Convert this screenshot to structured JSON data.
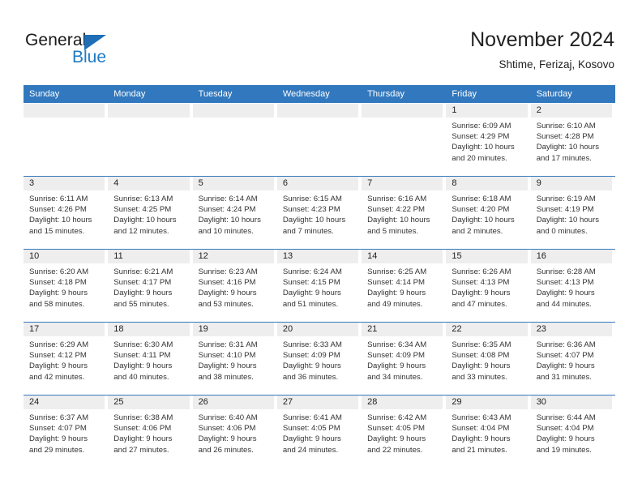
{
  "brand": {
    "name_part1": "General",
    "name_part2": "Blue",
    "triangle_color": "#1f6fb6",
    "blue_text_color": "#1f7bc4"
  },
  "header": {
    "title": "November 2024",
    "location": "Shtime, Ferizaj, Kosovo",
    "accent_color": "#3278be",
    "daynum_band_color": "#eeeeee"
  },
  "weekdays": [
    "Sunday",
    "Monday",
    "Tuesday",
    "Wednesday",
    "Thursday",
    "Friday",
    "Saturday"
  ],
  "weeks": [
    [
      {
        "day": "",
        "sunrise": "",
        "sunset": "",
        "daylight1": "",
        "daylight2": ""
      },
      {
        "day": "",
        "sunrise": "",
        "sunset": "",
        "daylight1": "",
        "daylight2": ""
      },
      {
        "day": "",
        "sunrise": "",
        "sunset": "",
        "daylight1": "",
        "daylight2": ""
      },
      {
        "day": "",
        "sunrise": "",
        "sunset": "",
        "daylight1": "",
        "daylight2": ""
      },
      {
        "day": "",
        "sunrise": "",
        "sunset": "",
        "daylight1": "",
        "daylight2": ""
      },
      {
        "day": "1",
        "sunrise": "Sunrise: 6:09 AM",
        "sunset": "Sunset: 4:29 PM",
        "daylight1": "Daylight: 10 hours",
        "daylight2": "and 20 minutes."
      },
      {
        "day": "2",
        "sunrise": "Sunrise: 6:10 AM",
        "sunset": "Sunset: 4:28 PM",
        "daylight1": "Daylight: 10 hours",
        "daylight2": "and 17 minutes."
      }
    ],
    [
      {
        "day": "3",
        "sunrise": "Sunrise: 6:11 AM",
        "sunset": "Sunset: 4:26 PM",
        "daylight1": "Daylight: 10 hours",
        "daylight2": "and 15 minutes."
      },
      {
        "day": "4",
        "sunrise": "Sunrise: 6:13 AM",
        "sunset": "Sunset: 4:25 PM",
        "daylight1": "Daylight: 10 hours",
        "daylight2": "and 12 minutes."
      },
      {
        "day": "5",
        "sunrise": "Sunrise: 6:14 AM",
        "sunset": "Sunset: 4:24 PM",
        "daylight1": "Daylight: 10 hours",
        "daylight2": "and 10 minutes."
      },
      {
        "day": "6",
        "sunrise": "Sunrise: 6:15 AM",
        "sunset": "Sunset: 4:23 PM",
        "daylight1": "Daylight: 10 hours",
        "daylight2": "and 7 minutes."
      },
      {
        "day": "7",
        "sunrise": "Sunrise: 6:16 AM",
        "sunset": "Sunset: 4:22 PM",
        "daylight1": "Daylight: 10 hours",
        "daylight2": "and 5 minutes."
      },
      {
        "day": "8",
        "sunrise": "Sunrise: 6:18 AM",
        "sunset": "Sunset: 4:20 PM",
        "daylight1": "Daylight: 10 hours",
        "daylight2": "and 2 minutes."
      },
      {
        "day": "9",
        "sunrise": "Sunrise: 6:19 AM",
        "sunset": "Sunset: 4:19 PM",
        "daylight1": "Daylight: 10 hours",
        "daylight2": "and 0 minutes."
      }
    ],
    [
      {
        "day": "10",
        "sunrise": "Sunrise: 6:20 AM",
        "sunset": "Sunset: 4:18 PM",
        "daylight1": "Daylight: 9 hours",
        "daylight2": "and 58 minutes."
      },
      {
        "day": "11",
        "sunrise": "Sunrise: 6:21 AM",
        "sunset": "Sunset: 4:17 PM",
        "daylight1": "Daylight: 9 hours",
        "daylight2": "and 55 minutes."
      },
      {
        "day": "12",
        "sunrise": "Sunrise: 6:23 AM",
        "sunset": "Sunset: 4:16 PM",
        "daylight1": "Daylight: 9 hours",
        "daylight2": "and 53 minutes."
      },
      {
        "day": "13",
        "sunrise": "Sunrise: 6:24 AM",
        "sunset": "Sunset: 4:15 PM",
        "daylight1": "Daylight: 9 hours",
        "daylight2": "and 51 minutes."
      },
      {
        "day": "14",
        "sunrise": "Sunrise: 6:25 AM",
        "sunset": "Sunset: 4:14 PM",
        "daylight1": "Daylight: 9 hours",
        "daylight2": "and 49 minutes."
      },
      {
        "day": "15",
        "sunrise": "Sunrise: 6:26 AM",
        "sunset": "Sunset: 4:13 PM",
        "daylight1": "Daylight: 9 hours",
        "daylight2": "and 47 minutes."
      },
      {
        "day": "16",
        "sunrise": "Sunrise: 6:28 AM",
        "sunset": "Sunset: 4:13 PM",
        "daylight1": "Daylight: 9 hours",
        "daylight2": "and 44 minutes."
      }
    ],
    [
      {
        "day": "17",
        "sunrise": "Sunrise: 6:29 AM",
        "sunset": "Sunset: 4:12 PM",
        "daylight1": "Daylight: 9 hours",
        "daylight2": "and 42 minutes."
      },
      {
        "day": "18",
        "sunrise": "Sunrise: 6:30 AM",
        "sunset": "Sunset: 4:11 PM",
        "daylight1": "Daylight: 9 hours",
        "daylight2": "and 40 minutes."
      },
      {
        "day": "19",
        "sunrise": "Sunrise: 6:31 AM",
        "sunset": "Sunset: 4:10 PM",
        "daylight1": "Daylight: 9 hours",
        "daylight2": "and 38 minutes."
      },
      {
        "day": "20",
        "sunrise": "Sunrise: 6:33 AM",
        "sunset": "Sunset: 4:09 PM",
        "daylight1": "Daylight: 9 hours",
        "daylight2": "and 36 minutes."
      },
      {
        "day": "21",
        "sunrise": "Sunrise: 6:34 AM",
        "sunset": "Sunset: 4:09 PM",
        "daylight1": "Daylight: 9 hours",
        "daylight2": "and 34 minutes."
      },
      {
        "day": "22",
        "sunrise": "Sunrise: 6:35 AM",
        "sunset": "Sunset: 4:08 PM",
        "daylight1": "Daylight: 9 hours",
        "daylight2": "and 33 minutes."
      },
      {
        "day": "23",
        "sunrise": "Sunrise: 6:36 AM",
        "sunset": "Sunset: 4:07 PM",
        "daylight1": "Daylight: 9 hours",
        "daylight2": "and 31 minutes."
      }
    ],
    [
      {
        "day": "24",
        "sunrise": "Sunrise: 6:37 AM",
        "sunset": "Sunset: 4:07 PM",
        "daylight1": "Daylight: 9 hours",
        "daylight2": "and 29 minutes."
      },
      {
        "day": "25",
        "sunrise": "Sunrise: 6:38 AM",
        "sunset": "Sunset: 4:06 PM",
        "daylight1": "Daylight: 9 hours",
        "daylight2": "and 27 minutes."
      },
      {
        "day": "26",
        "sunrise": "Sunrise: 6:40 AM",
        "sunset": "Sunset: 4:06 PM",
        "daylight1": "Daylight: 9 hours",
        "daylight2": "and 26 minutes."
      },
      {
        "day": "27",
        "sunrise": "Sunrise: 6:41 AM",
        "sunset": "Sunset: 4:05 PM",
        "daylight1": "Daylight: 9 hours",
        "daylight2": "and 24 minutes."
      },
      {
        "day": "28",
        "sunrise": "Sunrise: 6:42 AM",
        "sunset": "Sunset: 4:05 PM",
        "daylight1": "Daylight: 9 hours",
        "daylight2": "and 22 minutes."
      },
      {
        "day": "29",
        "sunrise": "Sunrise: 6:43 AM",
        "sunset": "Sunset: 4:04 PM",
        "daylight1": "Daylight: 9 hours",
        "daylight2": "and 21 minutes."
      },
      {
        "day": "30",
        "sunrise": "Sunrise: 6:44 AM",
        "sunset": "Sunset: 4:04 PM",
        "daylight1": "Daylight: 9 hours",
        "daylight2": "and 19 minutes."
      }
    ]
  ]
}
